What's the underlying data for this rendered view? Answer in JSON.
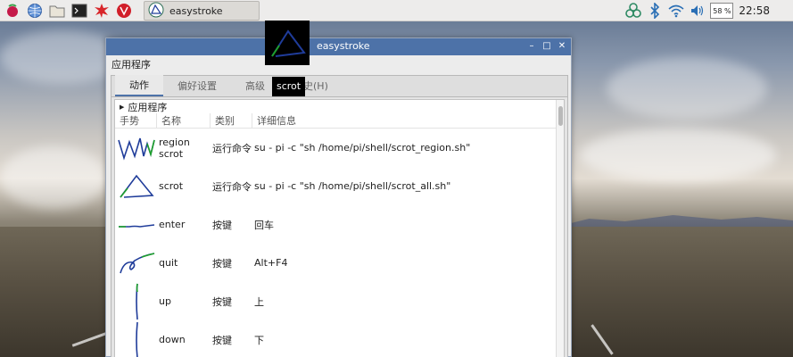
{
  "taskbar": {
    "app_button_label": "easystroke"
  },
  "tray": {
    "cpu_text": "58 %",
    "clock": "22:58"
  },
  "window": {
    "title": "easystroke",
    "menu": {
      "app_menu": "应用程序"
    },
    "tabs": [
      {
        "label": "动作"
      },
      {
        "label": "偏好设置"
      },
      {
        "label": "高级"
      },
      {
        "label": "历史(H)"
      }
    ],
    "tooltip": "scrot",
    "group_label": "应用程序",
    "columns": [
      "手势",
      "名称",
      "类别",
      "详细信息"
    ],
    "rows": [
      {
        "name": "region scrot",
        "type": "运行命令",
        "detail": "su - pi -c \"sh /home/pi/shell/scrot_region.sh\""
      },
      {
        "name": "scrot",
        "type": "运行命令",
        "detail": "su - pi -c \"sh /home/pi/shell/scrot_all.sh\""
      },
      {
        "name": "enter",
        "type": "按键",
        "detail": "回车"
      },
      {
        "name": "quit",
        "type": "按键",
        "detail": "Alt+F4"
      },
      {
        "name": "up",
        "type": "按键",
        "detail": "上"
      },
      {
        "name": "down",
        "type": "按键",
        "detail": "下"
      }
    ]
  },
  "colors": {
    "titlebar": "#4d72a8",
    "stroke_blue": "#1f3c9a",
    "stroke_green": "#1ea12a"
  },
  "icons": [
    "raspberry-icon",
    "globe-icon",
    "folder-icon",
    "terminal-icon",
    "burst-icon",
    "wolfram-icon",
    "easystroke-icon",
    "bluetooth-icon",
    "wifi-icon",
    "volume-icon"
  ]
}
